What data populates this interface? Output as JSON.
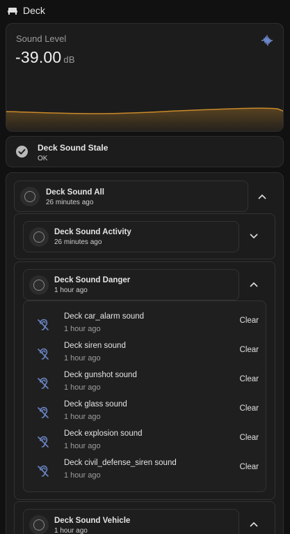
{
  "header": {
    "title": "Deck",
    "icon": "sofa-icon"
  },
  "sound_level": {
    "label": "Sound Level",
    "value": "-39.00",
    "unit": "dB",
    "icon": "waveform-icon",
    "graph_color": "#c98a2a"
  },
  "stale": {
    "name": "Deck Sound Stale",
    "state": "OK",
    "icon": "check-circle-icon"
  },
  "groups": {
    "all": {
      "name": "Deck Sound All",
      "time": "26 minutes ago"
    },
    "activity": {
      "name": "Deck Sound Activity",
      "time": "26 minutes ago"
    },
    "danger": {
      "name": "Deck Sound Danger",
      "time": "1 hour ago"
    },
    "vehicle": {
      "name": "Deck Sound Vehicle",
      "time": "1 hour ago"
    }
  },
  "events": [
    {
      "name": "Deck car_alarm sound",
      "time": "1 hour ago",
      "action": "Clear"
    },
    {
      "name": "Deck siren sound",
      "time": "1 hour ago",
      "action": "Clear"
    },
    {
      "name": "Deck gunshot sound",
      "time": "1 hour ago",
      "action": "Clear"
    },
    {
      "name": "Deck glass sound",
      "time": "1 hour ago",
      "action": "Clear"
    },
    {
      "name": "Deck explosion sound",
      "time": "1 hour ago",
      "action": "Clear"
    },
    {
      "name": "Deck civil_defense_siren sound",
      "time": "1 hour ago",
      "action": "Clear"
    }
  ],
  "colors": {
    "accent": "#c98a2a",
    "icon_blue": "#6b86c6",
    "background": "#111111"
  }
}
